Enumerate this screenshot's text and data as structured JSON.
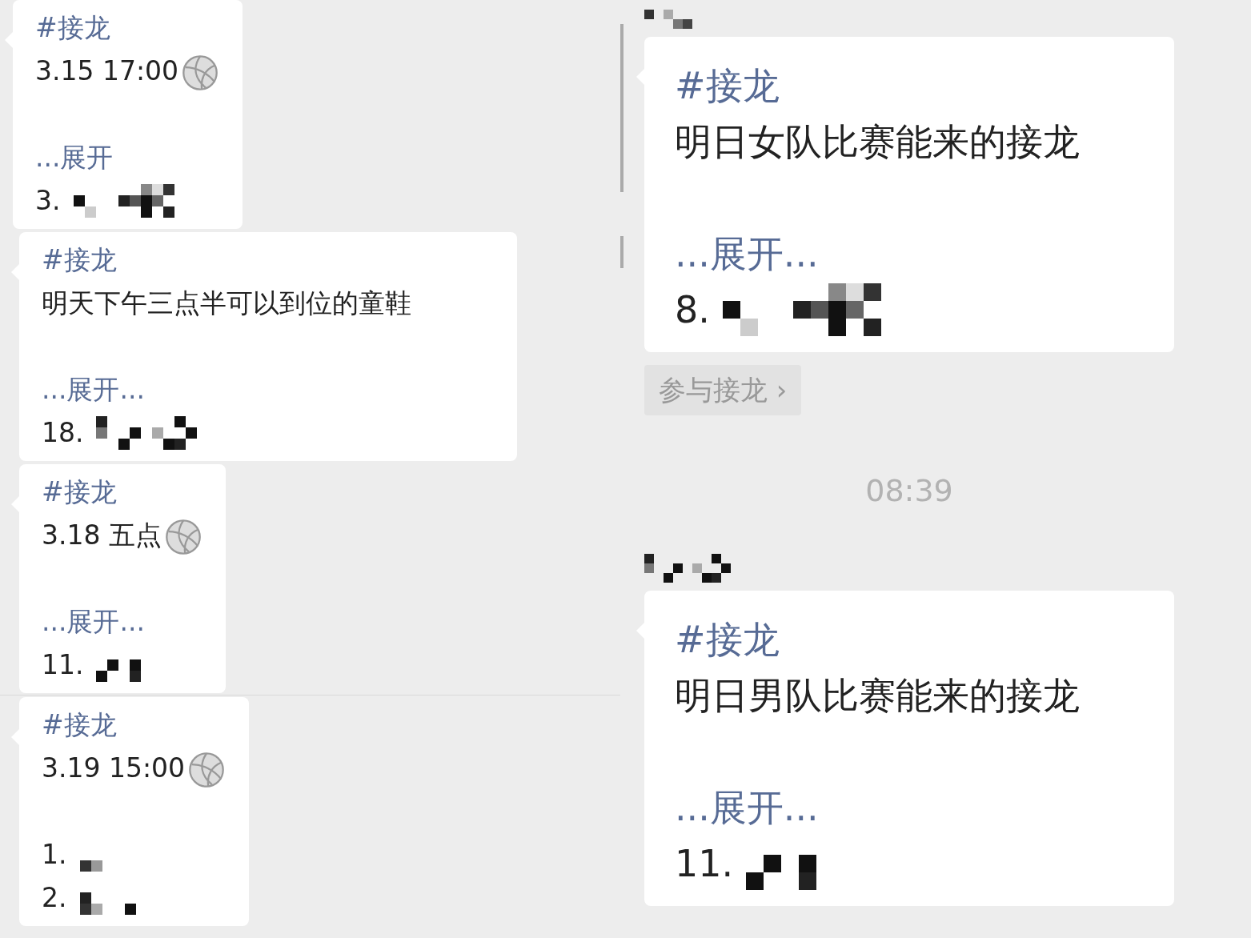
{
  "left_messages": [
    {
      "tag": "#接龙",
      "title": "3.15 17:00",
      "kind": "with-ball",
      "expand": "...展开",
      "entries": [
        "3."
      ]
    },
    {
      "tag": "#接龙",
      "title": "明天下午三点半可以到位的童鞋",
      "kind": "plain",
      "expand": "...展开...",
      "entries": [
        "18."
      ]
    },
    {
      "tag": "#接龙",
      "title": "3.18 五点",
      "kind": "with-ball",
      "expand": "...展开...",
      "entries": [
        "11."
      ]
    },
    {
      "tag": "#接龙",
      "title": "3.19 15:00",
      "kind": "with-ball",
      "entries": [
        "1.",
        "2."
      ]
    }
  ],
  "right_messages": [
    {
      "tag": "#接龙",
      "title": "明日女队比赛能来的接龙",
      "expand": "...展开...",
      "entries": [
        "8."
      ],
      "join_button": {
        "label": "参与接龙",
        "arrow": "›"
      }
    },
    {
      "time": "08:39",
      "tag": "#接龙",
      "title": "明日男队比赛能来的接龙",
      "expand": "...展开...",
      "entries": [
        "11."
      ]
    }
  ]
}
